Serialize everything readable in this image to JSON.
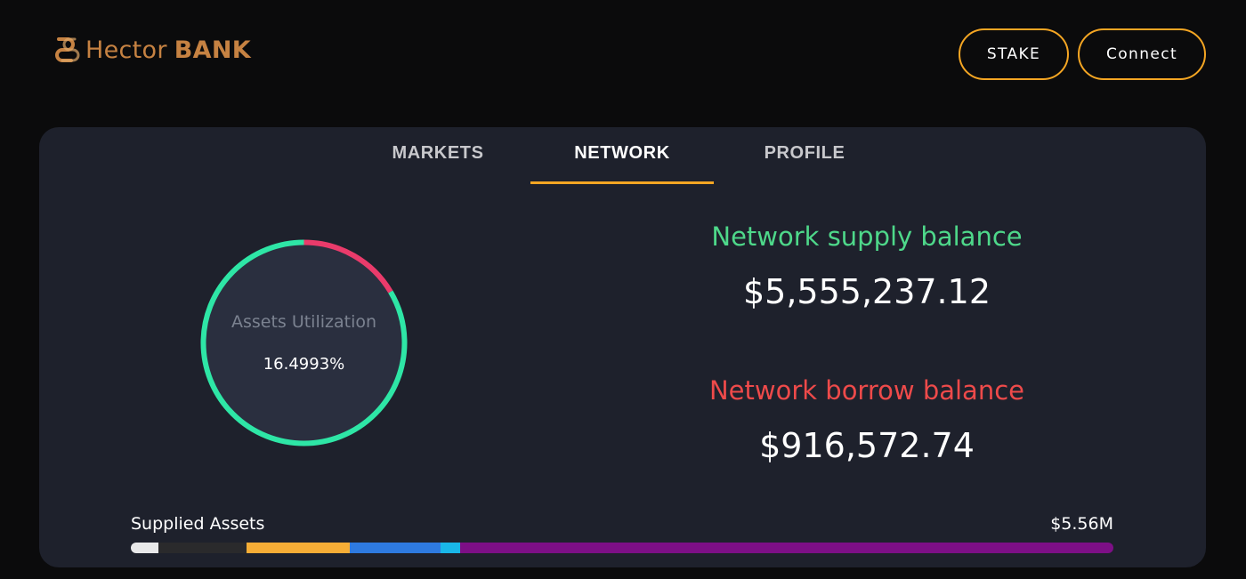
{
  "header": {
    "logo": {
      "name_light": "Hector",
      "name_bold": "BANK",
      "icon": "hector-logo-icon"
    },
    "buttons": {
      "stake_label": "STAKE",
      "connect_label": "Connect"
    },
    "accent_color": "#f5a623"
  },
  "tabs": [
    {
      "label": "MARKETS",
      "active": false
    },
    {
      "label": "NETWORK",
      "active": true
    },
    {
      "label": "PROFILE",
      "active": false
    }
  ],
  "utilization": {
    "label": "Assets Utilization",
    "value_text": "16.4993%",
    "fraction": 0.164993,
    "supply_color": "#2ee6a6",
    "borrow_color": "#ea3b6b"
  },
  "network": {
    "supply_title": "Network supply balance",
    "supply_value": "$5,555,237.12",
    "borrow_title": "Network borrow balance",
    "borrow_value": "$916,572.74"
  },
  "supplied_assets": {
    "label": "Supplied Assets",
    "total": "$5.56M",
    "segments": [
      {
        "color": "#e9e9ea",
        "share": 0.028
      },
      {
        "color": "#2a2a2c",
        "share": 0.09
      },
      {
        "color": "#f6ad36",
        "share": 0.105
      },
      {
        "color": "#2e7ae0",
        "share": 0.092
      },
      {
        "color": "#19b6e8",
        "share": 0.02
      },
      {
        "color": "#7d0f86",
        "share": 0.665
      }
    ]
  }
}
